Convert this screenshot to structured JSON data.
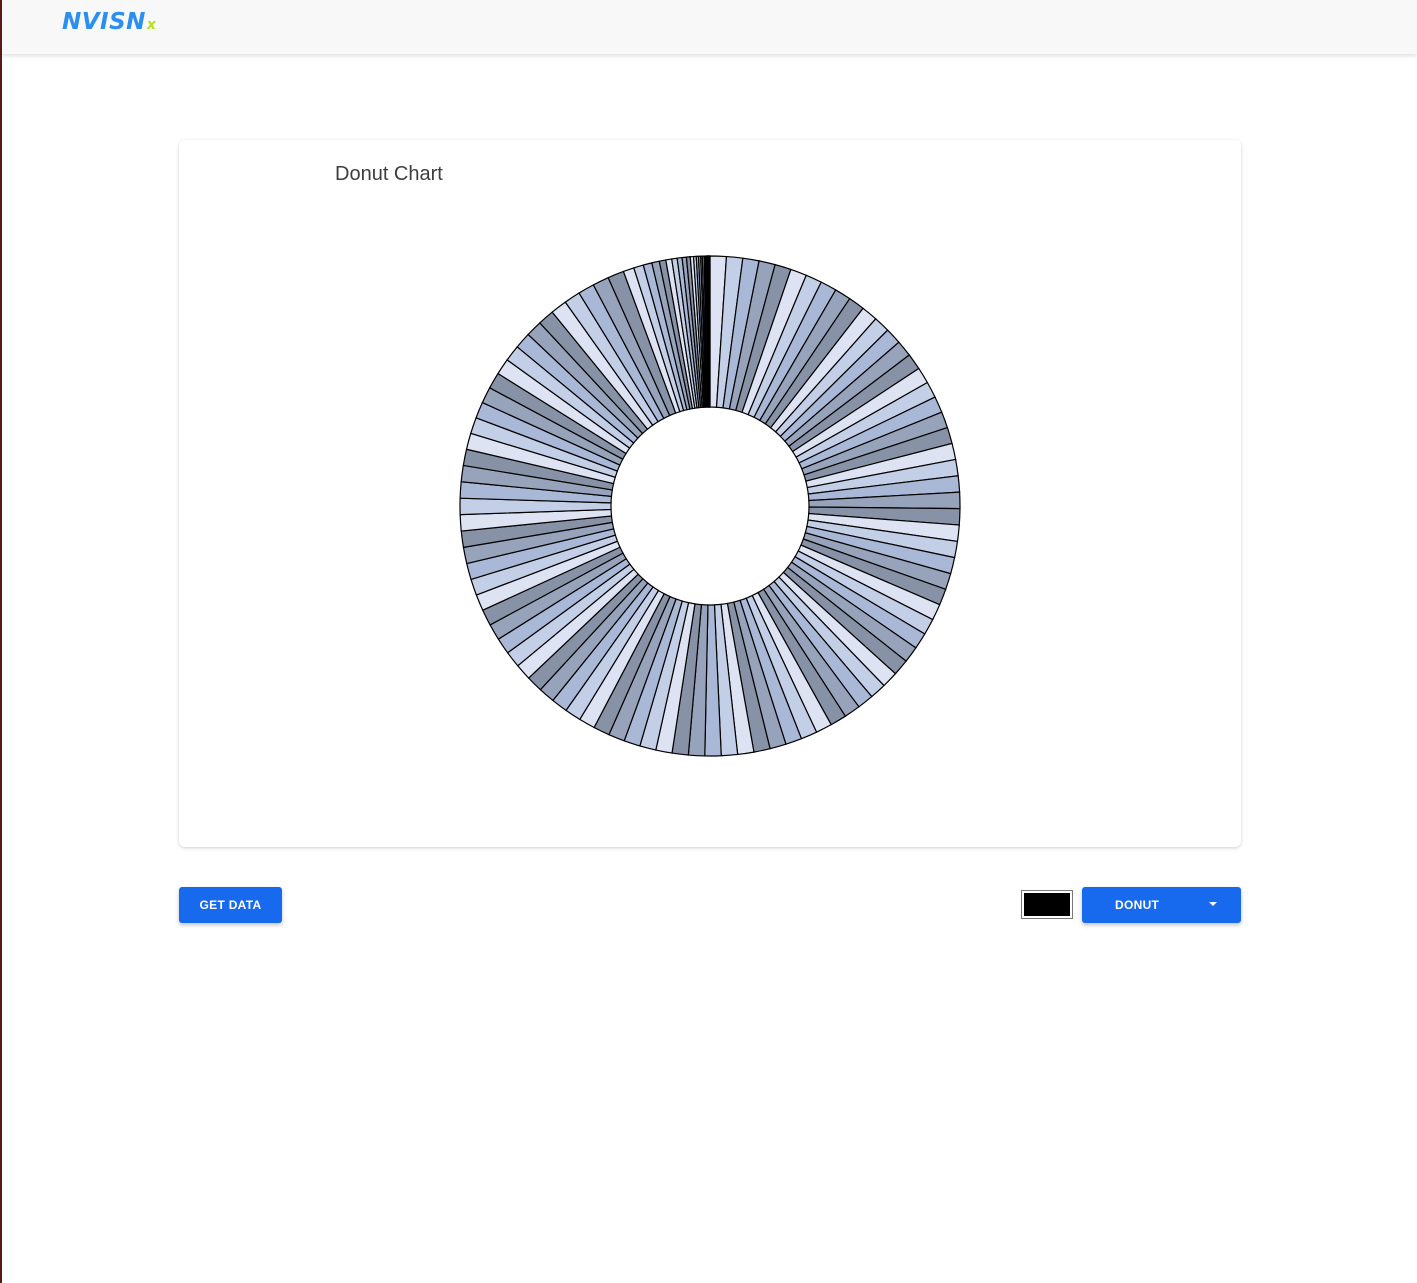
{
  "app": {
    "logo_text": "NVISN",
    "logo_suffix": "x"
  },
  "card": {
    "title": "Donut Chart"
  },
  "controls": {
    "get_data_label": "GET DATA",
    "swatch_color": "#000000",
    "chart_type_label": "DONUT"
  },
  "chart_data": {
    "type": "pie",
    "variant": "donut",
    "title": "Donut Chart",
    "values": [
      30,
      30,
      30,
      30,
      30,
      30,
      30,
      30,
      30,
      30,
      30,
      30,
      30,
      30,
      30,
      30,
      30,
      30,
      30,
      30,
      30,
      30,
      30,
      30,
      30,
      30,
      30,
      30,
      30,
      30,
      30,
      30,
      30,
      30,
      30,
      30,
      30,
      30,
      30,
      30,
      30,
      30,
      30,
      30,
      30,
      30,
      30,
      30,
      30,
      30,
      30,
      30,
      30,
      30,
      30,
      30,
      30,
      30,
      30,
      30,
      30,
      30,
      30,
      30,
      30,
      30,
      30,
      30,
      30,
      30,
      30,
      30,
      30,
      30,
      30,
      30,
      30,
      30,
      30,
      30,
      30,
      30,
      30,
      30,
      30,
      30,
      30,
      30,
      30,
      30,
      20,
      18,
      16,
      14,
      12,
      11,
      10,
      9,
      8,
      7,
      6,
      5,
      4,
      4,
      3,
      3,
      2,
      2,
      2,
      1,
      1,
      1,
      1,
      1
    ],
    "palette": [
      "#dde3f3",
      "#c2cfe7",
      "#a9b8d6",
      "#96a3ba",
      "#8792a6"
    ],
    "stroke_color": "#000000",
    "legend": "none"
  }
}
